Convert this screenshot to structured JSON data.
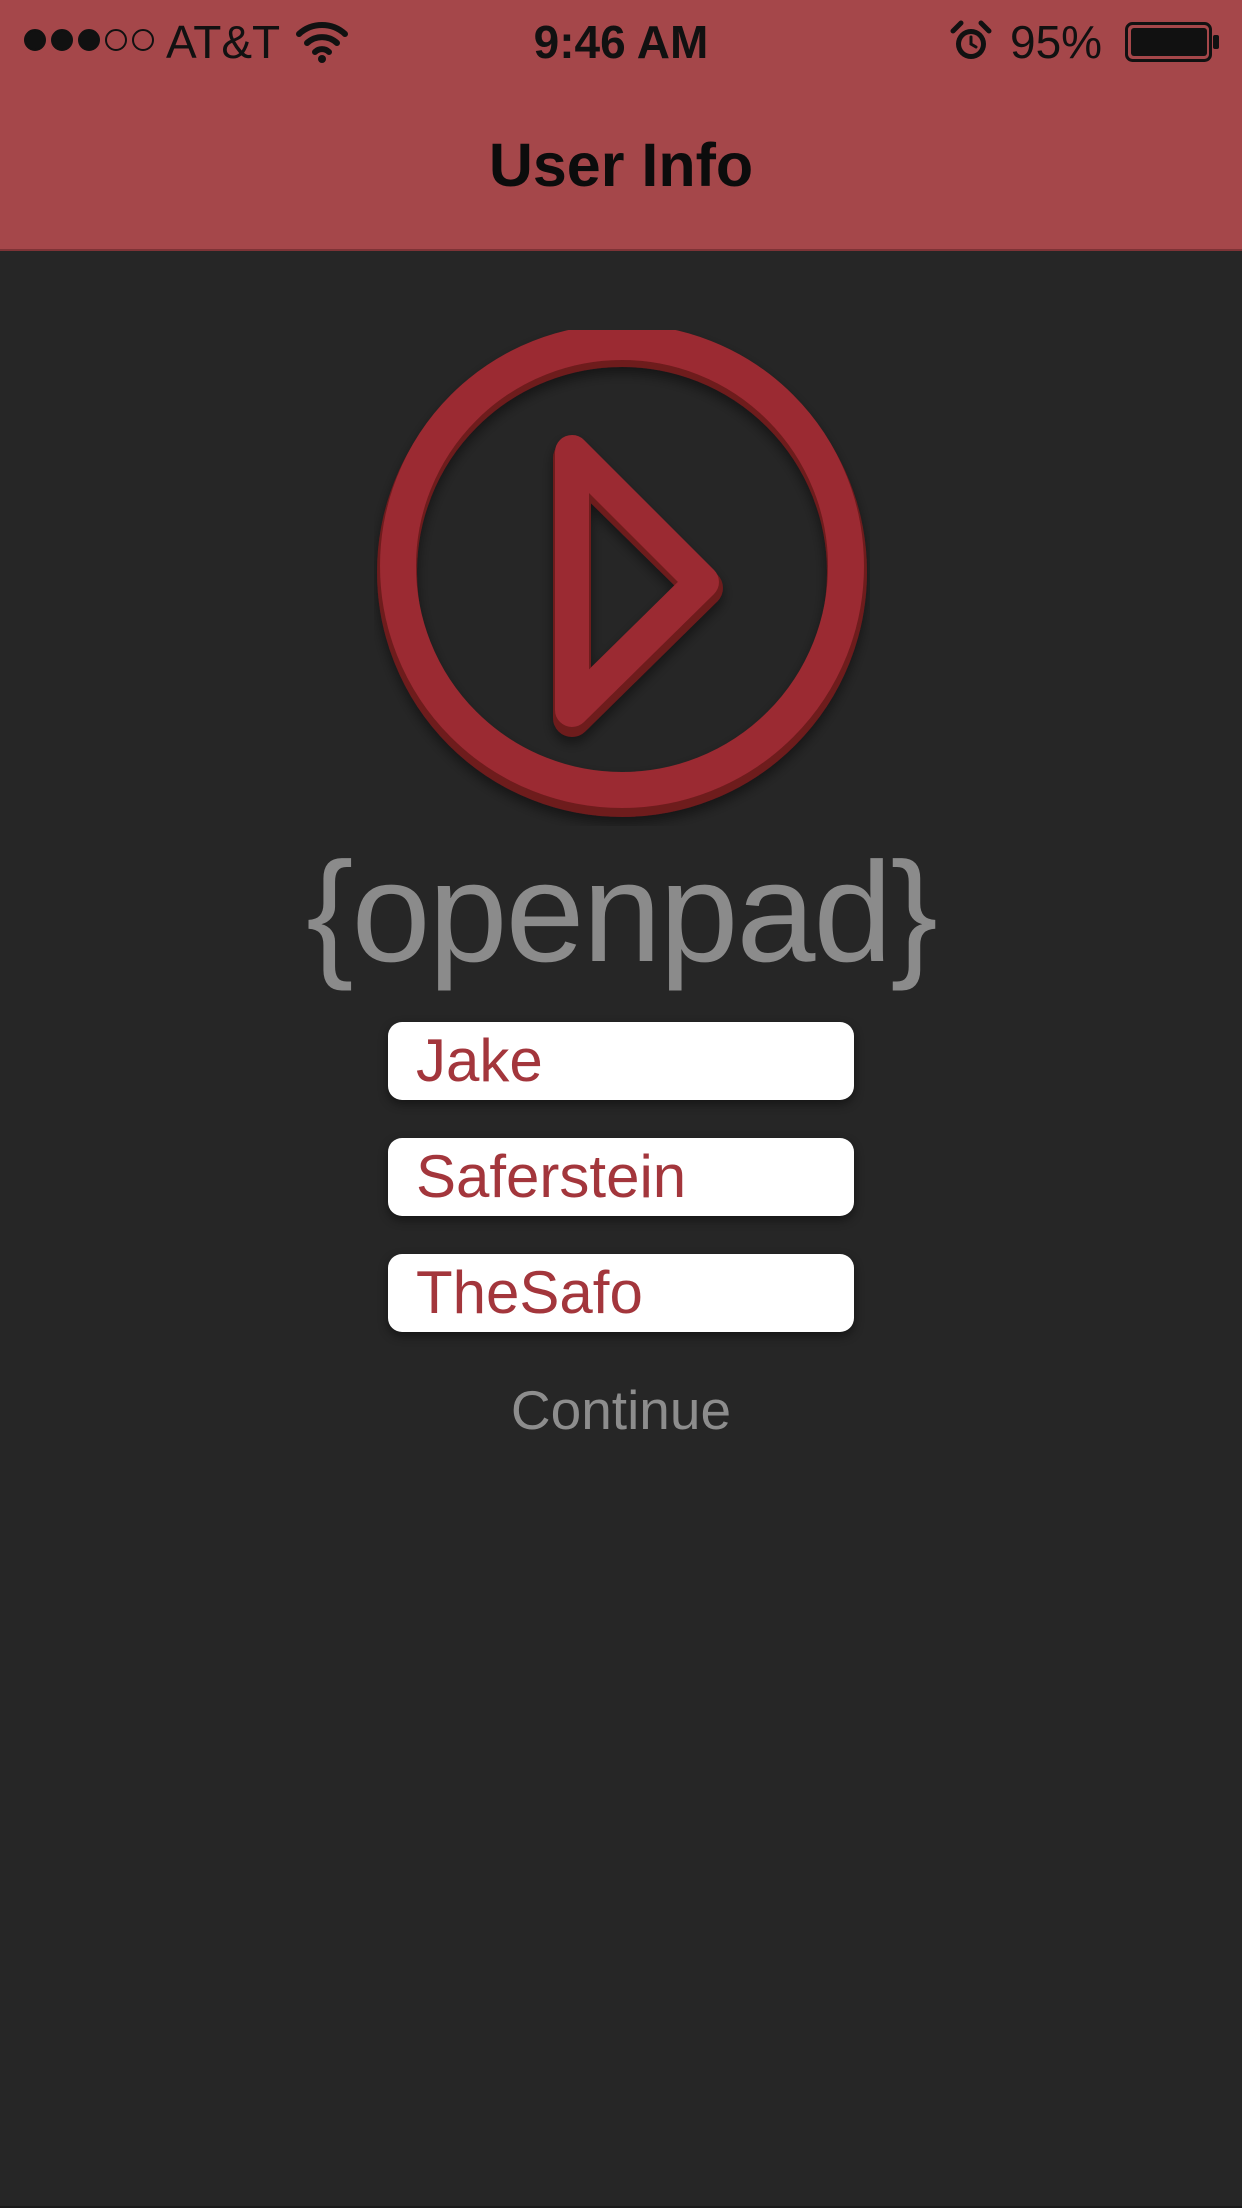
{
  "status_bar": {
    "signal_bars_filled": 3,
    "signal_bars_total": 5,
    "carrier": "AT&T",
    "time": "9:46 AM",
    "battery_percent": "95%",
    "icons": [
      "wifi-icon",
      "alarm-clock-icon",
      "battery-icon"
    ]
  },
  "nav": {
    "title": "User Info",
    "bar_color": "#a5474a"
  },
  "brand": {
    "wordmark": "{openpad}",
    "logo_icon": "play-circle-icon",
    "accent_color": "#9b2a30"
  },
  "form": {
    "first_name": "Jake",
    "last_name": "Saferstein",
    "username": "TheSafo",
    "text_color": "#a3363c"
  },
  "actions": {
    "continue_label": "Continue"
  }
}
